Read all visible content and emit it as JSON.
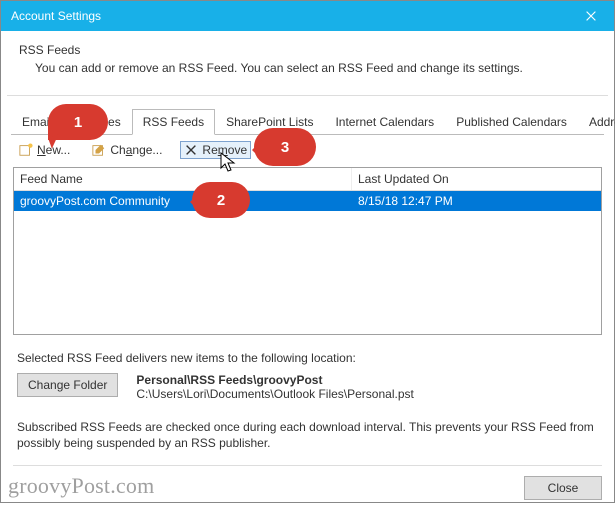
{
  "window": {
    "title": "Account Settings"
  },
  "header": {
    "title": "RSS Feeds",
    "subtitle": "You can add or remove an RSS Feed. You can select an RSS Feed and change its settings."
  },
  "tabs": [
    {
      "label": "Email",
      "active": false
    },
    {
      "label": "es",
      "active": false
    },
    {
      "label": "RSS Feeds",
      "active": true
    },
    {
      "label": "SharePoint Lists",
      "active": false
    },
    {
      "label": "Internet Calendars",
      "active": false
    },
    {
      "label": "Published Calendars",
      "active": false
    },
    {
      "label": "Address Books",
      "active": false
    }
  ],
  "toolbar": {
    "new_label": "New...",
    "change_label": "Change...",
    "remove_label": "Remove"
  },
  "grid": {
    "columns": [
      "Feed Name",
      "Last Updated On"
    ],
    "rows": [
      {
        "name": "groovyPost.com Community",
        "updated": "8/15/18 12:47 PM"
      }
    ]
  },
  "delivery": {
    "text": "Selected RSS Feed delivers new items to the following location:",
    "change_folder_label": "Change Folder",
    "folder_path_bold": "Personal\\RSS Feeds\\groovyPost",
    "folder_file": "C:\\Users\\Lori\\Documents\\Outlook Files\\Personal.pst"
  },
  "subscribe_note": "Subscribed RSS Feeds are checked once during each download interval. This prevents your RSS Feed from possibly being suspended by an RSS publisher.",
  "footer": {
    "close_label": "Close"
  },
  "callouts": {
    "c1": "1",
    "c2": "2",
    "c3": "3"
  },
  "watermark": "groovyPost.com"
}
